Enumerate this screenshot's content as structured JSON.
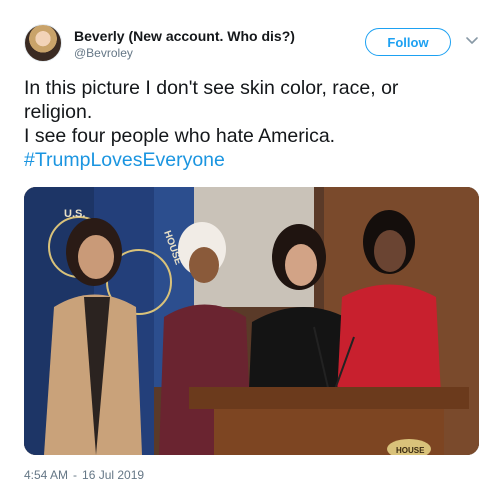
{
  "user": {
    "display_name": "Beverly (New account. Who dis?)",
    "handle": "@Bevroley"
  },
  "actions": {
    "follow_label": "Follow"
  },
  "tweet": {
    "lines": [
      "In this picture I don't see skin color, race, or",
      "religion.",
      "I see four people who hate America."
    ],
    "hashtag": "#TrumpLovesEveryone"
  },
  "media": {
    "flag_text_1": "U.S.",
    "flag_text_2": "HOUSE",
    "podium_text": "HOUSE"
  },
  "meta": {
    "time": "4:54 AM",
    "separator": "-",
    "date": "16 Jul 2019"
  },
  "colors": {
    "accent": "#1da1f2",
    "hashtag": "#1b95e0",
    "muted": "#657786"
  },
  "icons": {
    "caret": "chevron-down-icon",
    "avatar": "profile-avatar"
  }
}
